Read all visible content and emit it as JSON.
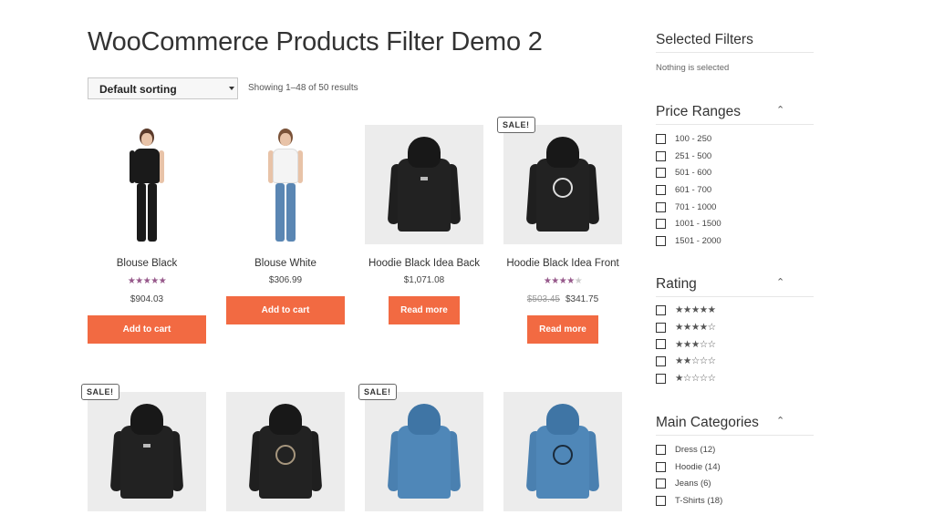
{
  "page": {
    "title": "WooCommerce Products Filter Demo 2"
  },
  "toolbar": {
    "sort_value": "Default sorting",
    "result_count": "Showing 1–48 of 50 results"
  },
  "products": [
    {
      "name": "Blouse Black",
      "rating": 5,
      "price": "$904.03",
      "old_price": "",
      "button": "Add to cart",
      "sale": false
    },
    {
      "name": "Blouse White",
      "rating": 0,
      "price": "$306.99",
      "old_price": "",
      "button": "Add to cart",
      "sale": false
    },
    {
      "name": "Hoodie Black Idea Back",
      "rating": 0,
      "price": "$1,071.08",
      "old_price": "",
      "button": "Read more",
      "sale": false
    },
    {
      "name": "Hoodie Black Idea Front",
      "rating": 4,
      "price": "$341.75",
      "old_price": "$503.45",
      "button": "Read more",
      "sale": true
    },
    {
      "sale": true
    },
    {
      "sale": false
    },
    {
      "sale": true
    },
    {
      "sale": false
    }
  ],
  "sale_badge": "SALE!",
  "sidebar": {
    "selected": {
      "title": "Selected Filters",
      "empty_text": "Nothing is selected"
    },
    "price": {
      "title": "Price Ranges",
      "options": [
        "100 - 250",
        "251 - 500",
        "501 - 600",
        "601 - 700",
        "701 - 1000",
        "1001 - 1500",
        "1501 - 2000"
      ]
    },
    "rating": {
      "title": "Rating",
      "options": [
        "★★★★★",
        "★★★★☆",
        "★★★☆☆",
        "★★☆☆☆",
        "★☆☆☆☆"
      ]
    },
    "categories": {
      "title": "Main Categories",
      "options": [
        "Dress (12)",
        "Hoodie (14)",
        "Jeans (6)",
        "T-Shirts (18)"
      ]
    },
    "toggle_icon": "chevron-up-icon"
  },
  "colors": {
    "accent_button": "#f26a42",
    "star": "#96588a",
    "hoodie_black": "#1f1f1f",
    "hoodie_blue": "#4f87b8"
  }
}
